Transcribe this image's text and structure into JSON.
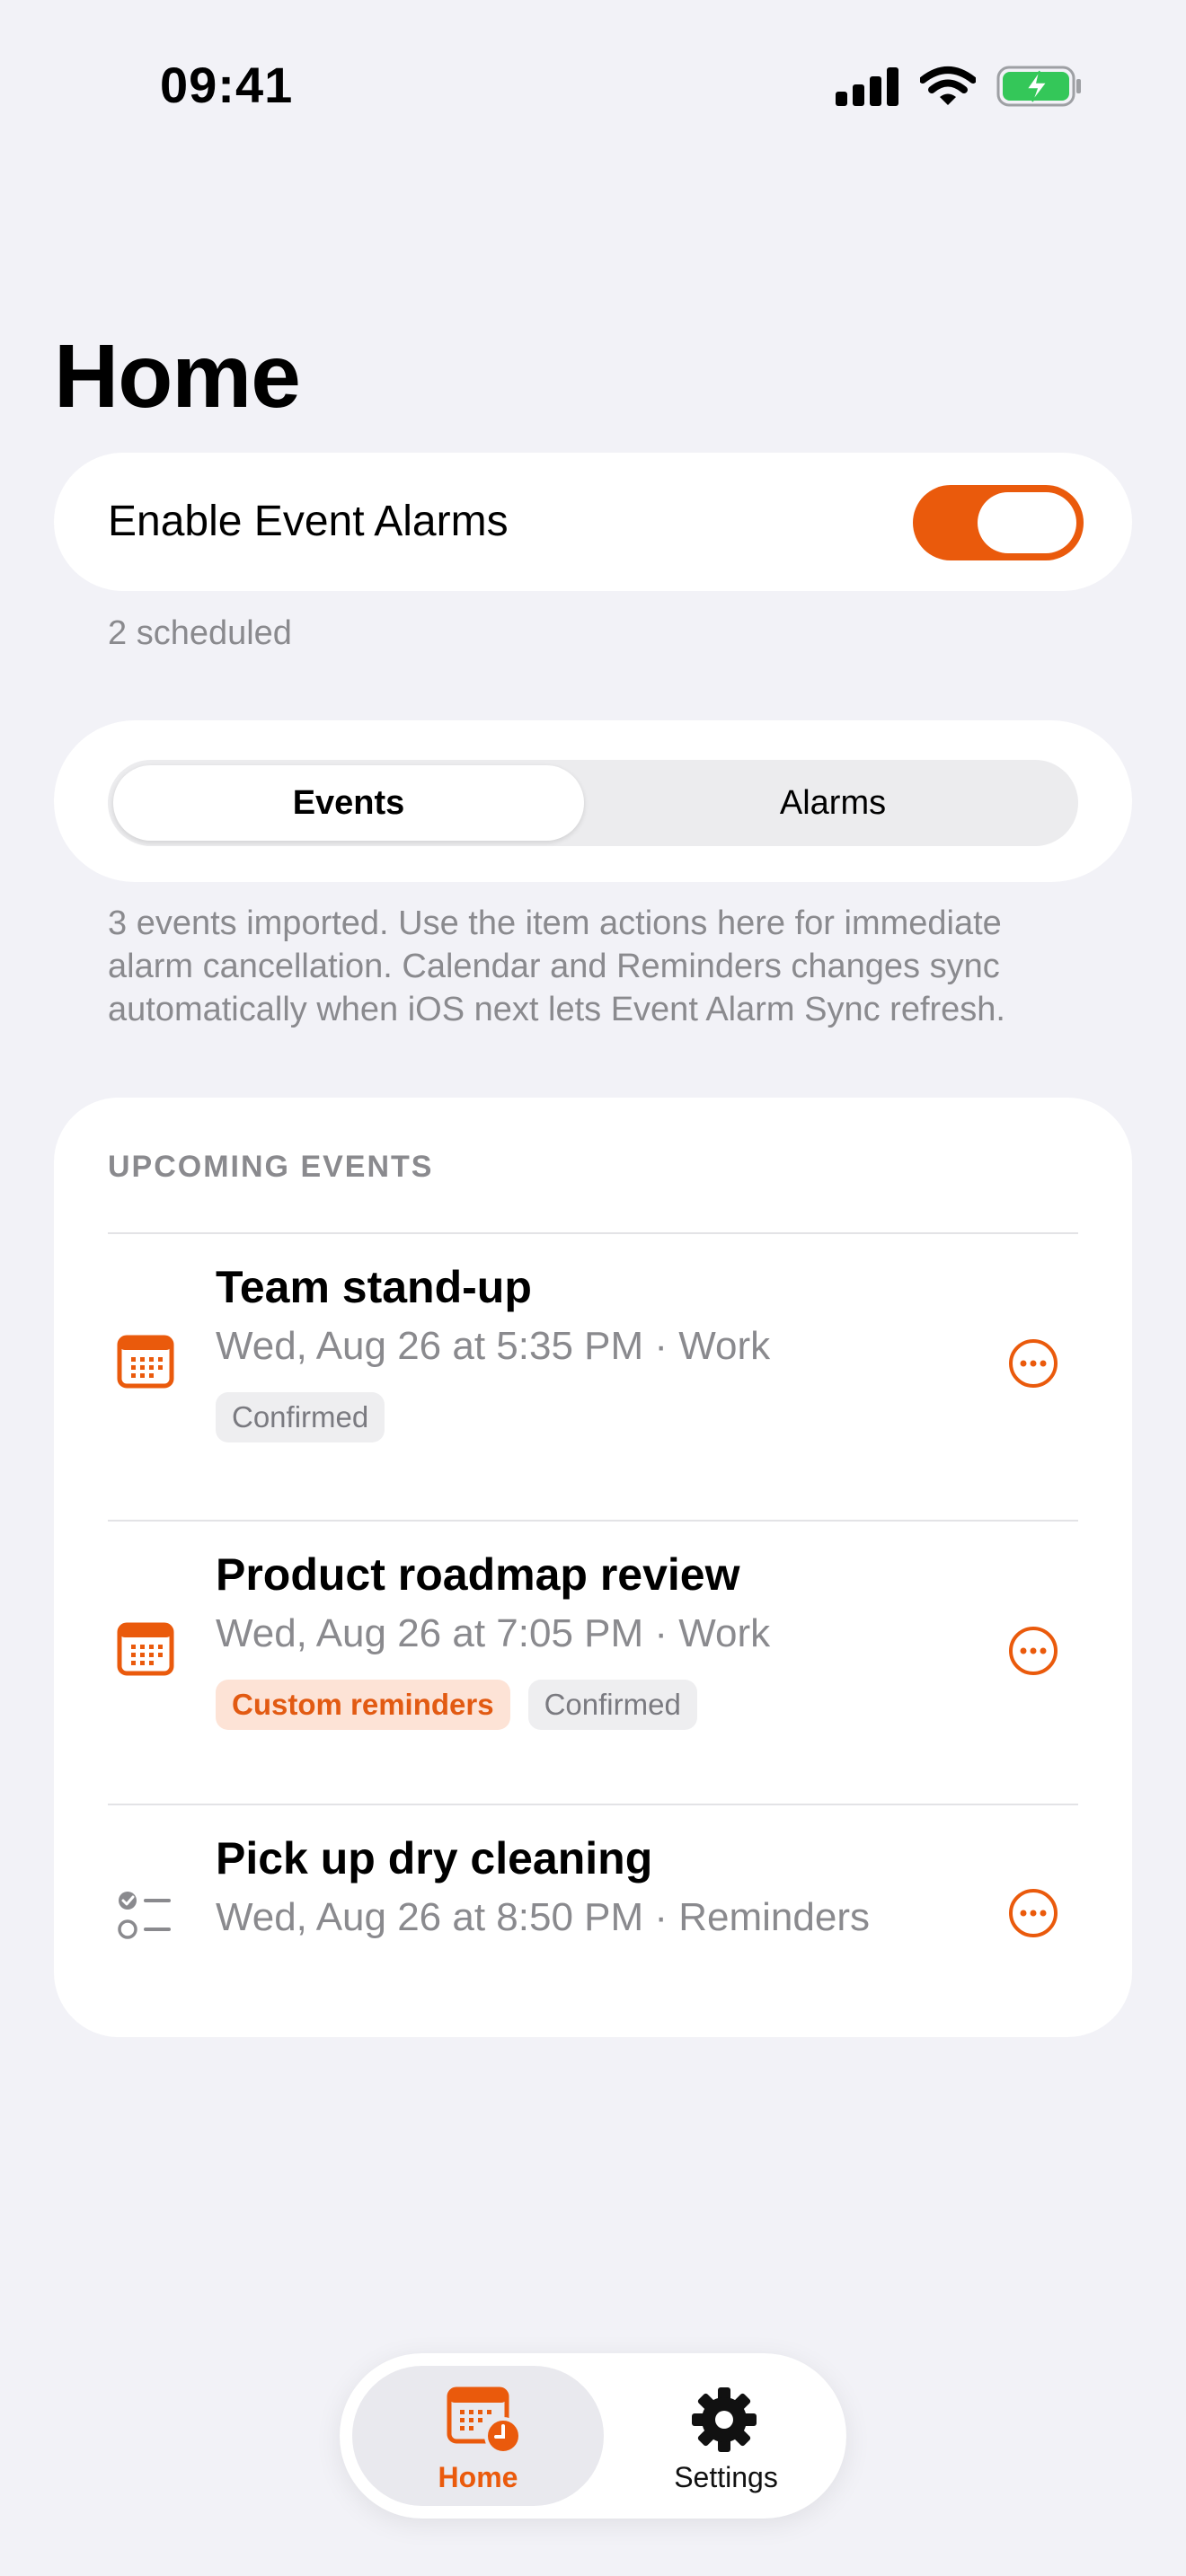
{
  "status_bar": {
    "time": "09:41"
  },
  "page_title": "Home",
  "alarms_toggle": {
    "label": "Enable Event Alarms",
    "enabled": true,
    "scheduled_text": "2 scheduled"
  },
  "segmented": {
    "options": [
      "Events",
      "Alarms"
    ],
    "selected": "Events"
  },
  "info_text": "3 events imported. Use the item actions here for immediate alarm cancellation. Calendar and Reminders changes sync automatically when iOS next lets Event Alarm Sync refresh.",
  "events_section": {
    "header": "UPCOMING EVENTS",
    "items": [
      {
        "title": "Team stand-up",
        "subtitle": "Wed, Aug 26 at 5:35 PM · Work",
        "icon": "calendar-icon",
        "badges": [
          "Confirmed"
        ]
      },
      {
        "title": "Product roadmap review",
        "subtitle": "Wed, Aug 26 at 7:05 PM · Work",
        "icon": "calendar-icon",
        "badges": [
          "Custom reminders",
          "Confirmed"
        ]
      },
      {
        "title": "Pick up dry cleaning",
        "subtitle": "Wed, Aug 26 at 8:50 PM · Reminders",
        "icon": "reminder-list-icon",
        "badges": []
      }
    ]
  },
  "tab_bar": {
    "tabs": [
      {
        "label": "Home",
        "icon": "calendar-clock-icon",
        "selected": true
      },
      {
        "label": "Settings",
        "icon": "gear-icon",
        "selected": false
      }
    ]
  },
  "colors": {
    "accent": "#EA5A0C",
    "background": "#F2F2F7",
    "secondary_text": "#8A8A8E",
    "battery_green": "#34C759"
  }
}
